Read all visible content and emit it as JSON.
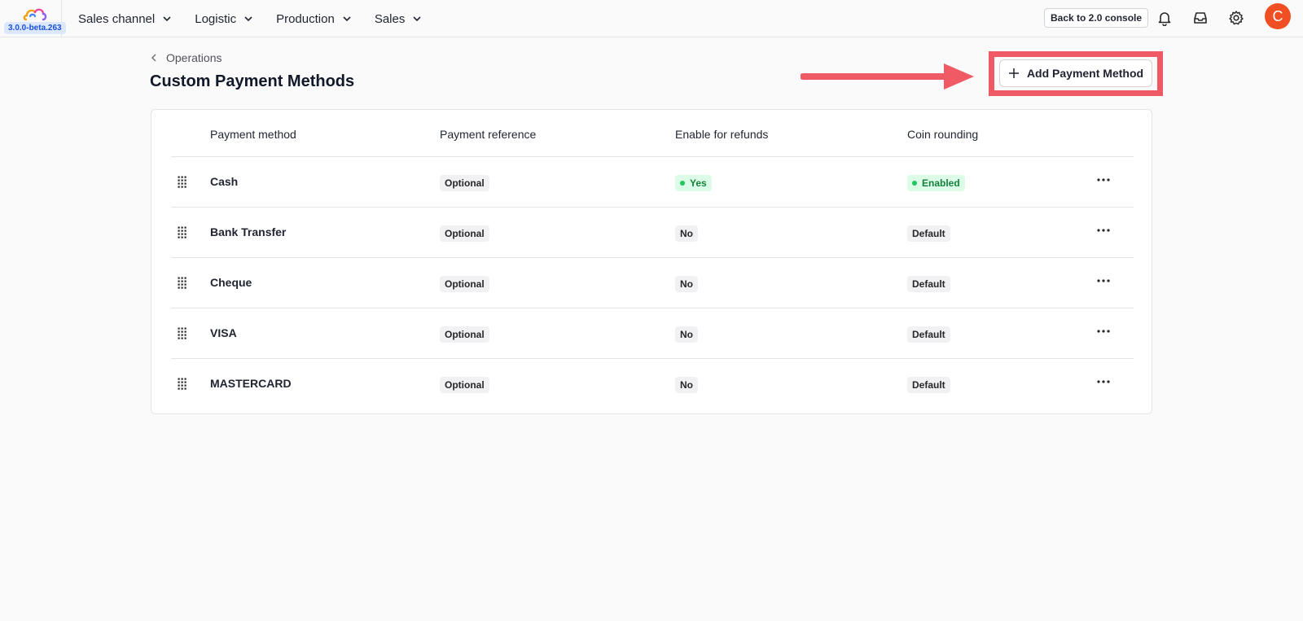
{
  "app": {
    "version": "3.0.0-beta.263",
    "avatar_initial": "C",
    "back_button": "Back to 2.0 console"
  },
  "nav": [
    {
      "label": "Sales channel",
      "icon": "chevron-down-icon"
    },
    {
      "label": "Logistic",
      "icon": "chevron-down-icon"
    },
    {
      "label": "Production",
      "icon": "chevron-down-icon"
    },
    {
      "label": "Sales",
      "icon": "chevron-down-icon"
    }
  ],
  "top_icons": [
    "bell-icon",
    "inbox-icon",
    "gear-icon"
  ],
  "breadcrumb": "Operations",
  "page_title": "Custom Payment Methods",
  "add_button": "Add Payment Method",
  "colors": {
    "accent_red": "#ef5a65",
    "avatar": "#f04f23",
    "success_text": "#15803d",
    "success_bg": "#dcfce7",
    "version_bg": "#dbe8ff"
  },
  "table": {
    "columns": [
      "Payment method",
      "Payment reference",
      "Enable for refunds",
      "Coin rounding"
    ],
    "rows": [
      {
        "name": "Cash",
        "reference": "Optional",
        "refunds": "Yes",
        "refunds_status": "success",
        "rounding": "Enabled",
        "rounding_status": "success"
      },
      {
        "name": "Bank Transfer",
        "reference": "Optional",
        "refunds": "No",
        "refunds_status": "neutral",
        "rounding": "Default",
        "rounding_status": "neutral"
      },
      {
        "name": "Cheque",
        "reference": "Optional",
        "refunds": "No",
        "refunds_status": "neutral",
        "rounding": "Default",
        "rounding_status": "neutral"
      },
      {
        "name": "VISA",
        "reference": "Optional",
        "refunds": "No",
        "refunds_status": "neutral",
        "rounding": "Default",
        "rounding_status": "neutral"
      },
      {
        "name": "MASTERCARD",
        "reference": "Optional",
        "refunds": "No",
        "refunds_status": "neutral",
        "rounding": "Default",
        "rounding_status": "neutral"
      }
    ]
  }
}
